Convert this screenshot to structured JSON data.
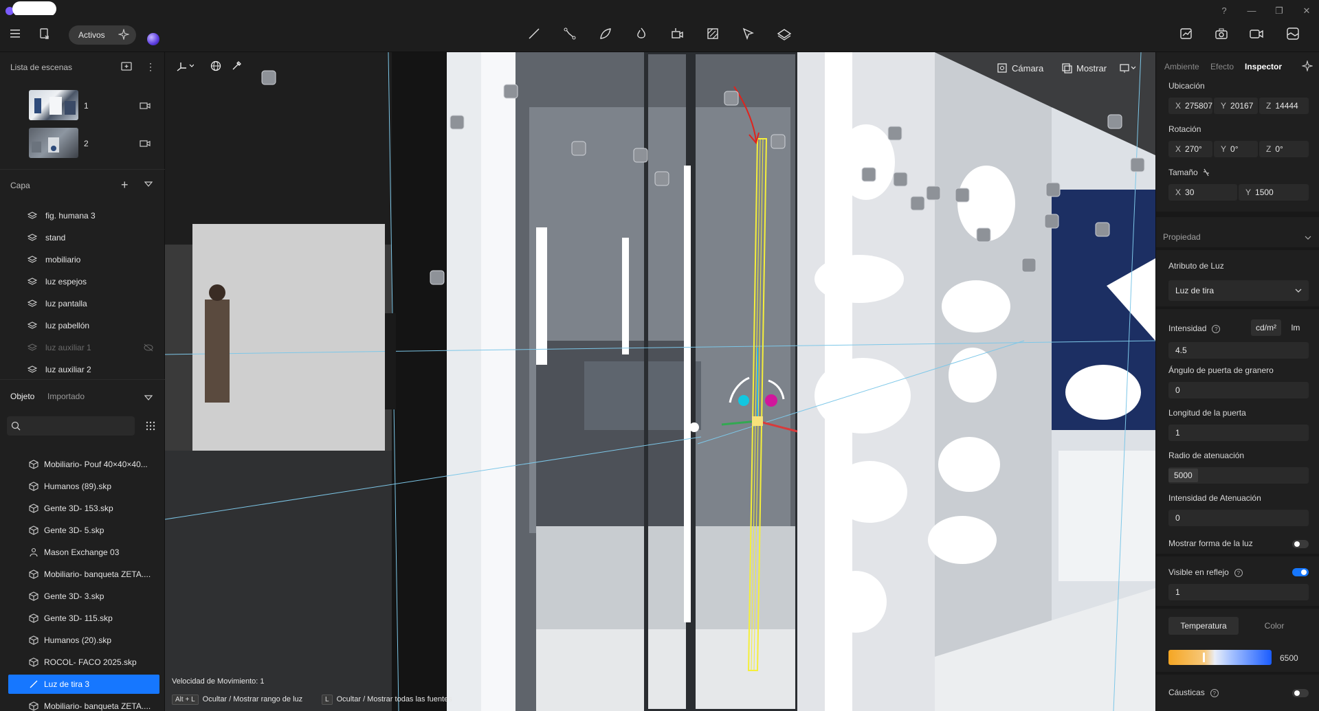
{
  "window": {
    "controls": [
      "?",
      "—",
      "❐",
      "✕"
    ]
  },
  "toolbar": {
    "mode_pill": "Activos",
    "center_tools": [
      "line-tool-icon",
      "polyline-tool-icon",
      "leaf-tool-icon",
      "fire-tool-icon",
      "camera-move-icon",
      "section-icon",
      "select-arrow-icon",
      "plane-icon"
    ],
    "right_tools": [
      "chart-icon",
      "photo-camera-icon",
      "video-camera-icon",
      "gallery-icon"
    ]
  },
  "scenes": {
    "title": "Lista de escenas",
    "items": [
      {
        "label": "1"
      },
      {
        "label": "2"
      }
    ]
  },
  "layers": {
    "title": "Capa",
    "items": [
      {
        "label": "fig. humana 3",
        "dim": false
      },
      {
        "label": "stand",
        "dim": false
      },
      {
        "label": "mobiliario",
        "dim": false
      },
      {
        "label": "luz espejos",
        "dim": false
      },
      {
        "label": "luz pantalla",
        "dim": false
      },
      {
        "label": "luz pabellón",
        "dim": false
      },
      {
        "label": "luz auxiliar 1",
        "dim": true
      },
      {
        "label": "luz auxiliar 2",
        "dim": false
      }
    ]
  },
  "objects": {
    "tab_active": "Objeto",
    "tab_inactive": "Importado",
    "items": [
      {
        "label": "Mobiliario- Pouf 40×40×40...",
        "icon": "box-icon",
        "selected": false
      },
      {
        "label": "Humanos (89).skp",
        "icon": "box-icon",
        "selected": false
      },
      {
        "label": "Gente 3D- 153.skp",
        "icon": "box-icon",
        "selected": false
      },
      {
        "label": "Gente 3D- 5.skp",
        "icon": "box-icon",
        "selected": false
      },
      {
        "label": "Mason Exchange 03",
        "icon": "person-icon",
        "selected": false
      },
      {
        "label": "Mobiliario- banqueta ZETA....",
        "icon": "box-icon",
        "selected": false
      },
      {
        "label": "Gente 3D- 3.skp",
        "icon": "box-icon",
        "selected": false
      },
      {
        "label": "Gente 3D- 115.skp",
        "icon": "box-icon",
        "selected": false
      },
      {
        "label": "Humanos (20).skp",
        "icon": "box-icon",
        "selected": false
      },
      {
        "label": "ROCOL- FACO 2025.skp",
        "icon": "box-icon",
        "selected": false
      },
      {
        "label": "Luz de tira 3",
        "icon": "strip-light-icon",
        "selected": true
      },
      {
        "label": "Mobiliario- banqueta ZETA....",
        "icon": "box-icon",
        "selected": false
      }
    ]
  },
  "viewport": {
    "camera_label": "Cámara",
    "show_label": "Mostrar",
    "speed_label": "Velocidad de Movimiento: 1",
    "hint1_key": "Alt + L",
    "hint1_text": "Ocultar / Mostrar rango de luz",
    "hint2_key": "L",
    "hint2_text": "Ocultar / Mostrar todas las fuentes"
  },
  "inspector": {
    "tabs": [
      "Ambiente",
      "Efecto",
      "Inspector"
    ],
    "location_label": "Ubicación",
    "location": {
      "x": "275807",
      "y": "20167",
      "z": "14444"
    },
    "rotation_label": "Rotación",
    "rotation": {
      "x": "270°",
      "y": "0°",
      "z": "0°"
    },
    "size_label": "Tamaño",
    "size": {
      "x": "30",
      "y": "1500"
    },
    "property_label": "Propiedad",
    "light_attr_label": "Atributo de Luz",
    "light_type": "Luz de tira",
    "intensity_label": "Intensidad",
    "unit_a": "cd/m²",
    "unit_b": "lm",
    "intensity": "4.5",
    "barn_angle_label": "Ángulo de puerta de granero",
    "barn_angle": "0",
    "door_length_label": "Longitud de la puerta",
    "door_length": "1",
    "atten_radius_label": "Radio de atenuación",
    "atten_radius": "5000",
    "atten_intensity_label": "Intensidad de Atenuación",
    "atten_intensity": "0",
    "show_shape_label": "Mostrar forma de la luz",
    "visible_reflection_label": "Visible en reflejo",
    "reflection_value": "1",
    "temp_tab": "Temperatura",
    "color_tab": "Color",
    "temperature": "6500",
    "caustics_label": "Cáusticas"
  }
}
